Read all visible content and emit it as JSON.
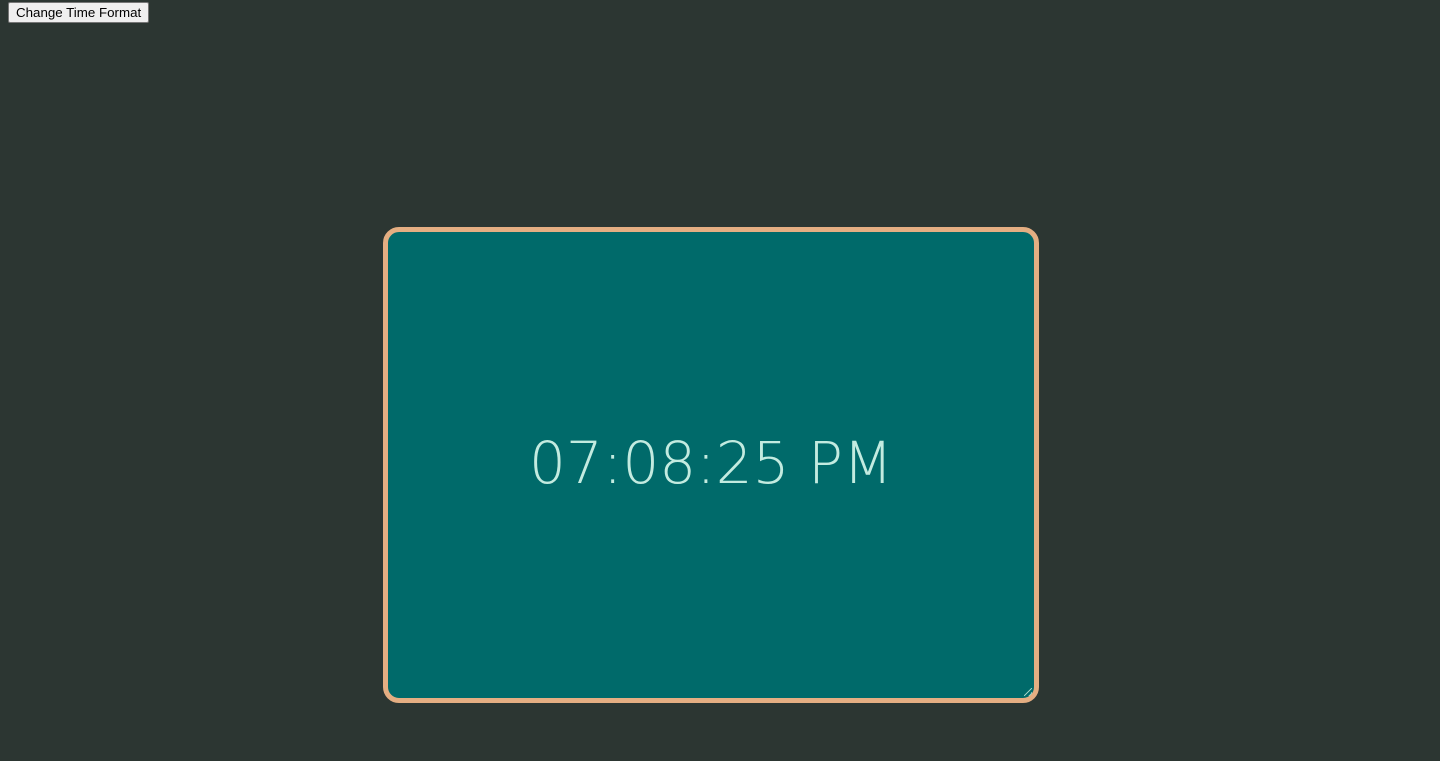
{
  "toolbar": {
    "change_format_label": "Change Time Format"
  },
  "clock": {
    "time_text": "07:08:25 PM",
    "format": "12-hour"
  },
  "colors": {
    "page_background": "#2c3632",
    "card_background": "#006a6a",
    "card_border": "#e4ae82",
    "time_text": "#c3ebe0"
  },
  "icons": {
    "resize_grip": "resize-grip-icon"
  }
}
